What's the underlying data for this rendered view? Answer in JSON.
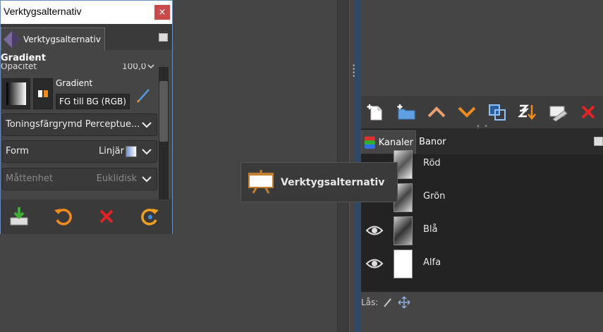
{
  "tool_options_window": {
    "title": "Verktygsalternativ",
    "close_label": "×",
    "tab_label": "Verktygsalternativ",
    "section_title": "Gradient",
    "opacity_label": "Opacitet",
    "opacity_value": "100,0",
    "gradient_label": "Gradient",
    "gradient_name": "FG till BG (RGB)",
    "blend_color_space_label": "Toningsfärgrymd Perceptue...",
    "shape_label": "Form",
    "shape_value": "Linjär",
    "metric_label": "Måttenhet",
    "metric_value": "Euklidisk"
  },
  "drag_label": {
    "text": "Verktygsalternativ"
  },
  "channels_dock": {
    "tabs": [
      {
        "label": "Kanaler"
      },
      {
        "label": "Banor"
      }
    ],
    "channels": [
      {
        "name": "Röd"
      },
      {
        "name": "Grön"
      },
      {
        "name": "Blå"
      },
      {
        "name": "Alfa"
      }
    ],
    "lock_label": "Lås:"
  },
  "colors": {
    "window_border": "#6b8fb8",
    "close_red": "#c84a4a",
    "orange": "#f08c1e",
    "red_x": "#e02424",
    "blue": "#3f8fe0"
  }
}
